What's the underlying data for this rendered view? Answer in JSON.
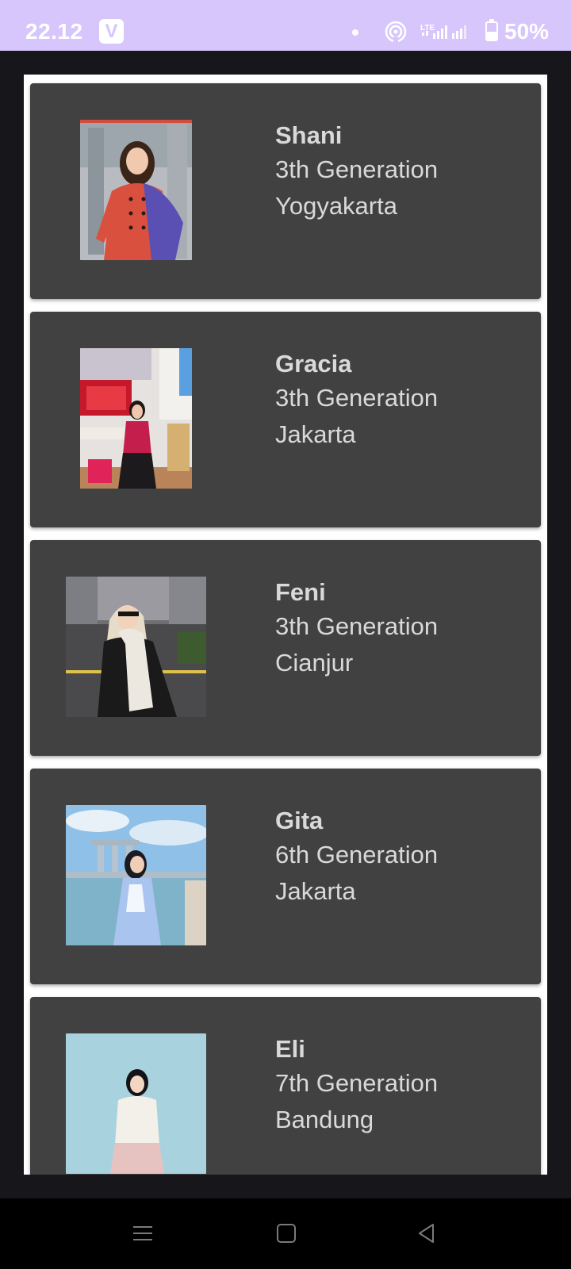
{
  "status_bar": {
    "time": "22.12",
    "app_icon_letter": "V",
    "network_label": "LTE",
    "battery_text": "50%",
    "battery_level": 0.5
  },
  "members": [
    {
      "name": "Shani",
      "generation": "3th Generation",
      "city": "Yogyakarta",
      "photo_icon": "portrait-photo"
    },
    {
      "name": "Gracia",
      "generation": "3th Generation",
      "city": "Jakarta",
      "photo_icon": "portrait-photo"
    },
    {
      "name": "Feni",
      "generation": "3th Generation",
      "city": "Cianjur",
      "photo_icon": "portrait-photo"
    },
    {
      "name": "Gita",
      "generation": "6th Generation",
      "city": "Jakarta",
      "photo_icon": "portrait-photo"
    },
    {
      "name": "Eli",
      "generation": "7th Generation",
      "city": "Bandung",
      "photo_icon": "portrait-photo"
    }
  ],
  "nav_bar": {
    "buttons": [
      "menu-icon",
      "home-square-icon",
      "back-triangle-icon"
    ]
  },
  "colors": {
    "status_bar_bg": "#d6c6fb",
    "card_bg": "#414141",
    "card_text": "#d9d9d9",
    "app_bg": "#17161b"
  }
}
